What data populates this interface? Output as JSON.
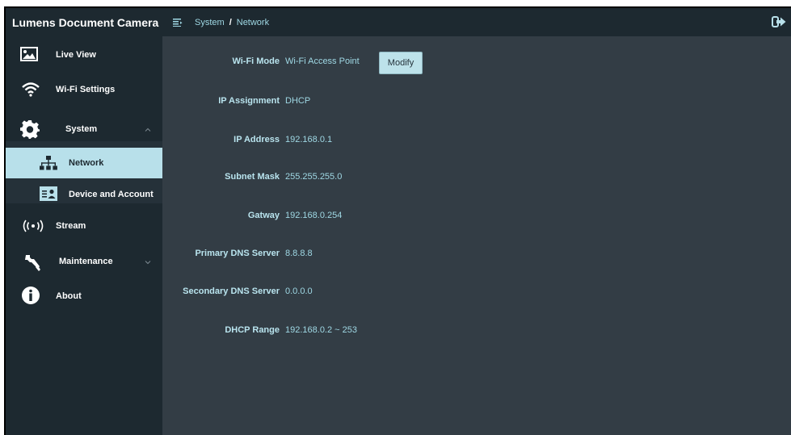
{
  "app": {
    "title": "Lumens Document Camera"
  },
  "breadcrumb": {
    "section": "System",
    "separator": "/",
    "page": "Network"
  },
  "sidebar": {
    "items": [
      {
        "label": "Live View",
        "icon": "image-icon"
      },
      {
        "label": "Wi-Fi Settings",
        "icon": "wifi-icon"
      },
      {
        "label": "System",
        "icon": "gear-icon",
        "expanded": true
      },
      {
        "label": "Network",
        "icon": "network-icon",
        "active": true
      },
      {
        "label": "Device and Account",
        "icon": "id-card-icon"
      },
      {
        "label": "Stream",
        "icon": "broadcast-icon"
      },
      {
        "label": "Maintenance",
        "icon": "wrench-icon",
        "expanded": false
      },
      {
        "label": "About",
        "icon": "info-icon"
      }
    ]
  },
  "network": {
    "wifi_mode": {
      "label": "Wi-Fi Mode",
      "value": "Wi-Fi Access Point",
      "button": "Modify"
    },
    "ip_assignment": {
      "label": "IP Assignment",
      "value": "DHCP"
    },
    "ip_address": {
      "label": "IP Address",
      "value": "192.168.0.1"
    },
    "subnet_mask": {
      "label": "Subnet Mask",
      "value": "255.255.255.0"
    },
    "gateway": {
      "label": "Gatway",
      "value": "192.168.0.254"
    },
    "primary_dns": {
      "label": "Primary DNS Server",
      "value": "8.8.8.8"
    },
    "secondary_dns": {
      "label": "Secondary DNS Server",
      "value": "0.0.0.0"
    },
    "dhcp_range": {
      "label": "DHCP Range",
      "value": "192.168.0.2 ~ 253"
    }
  },
  "colors": {
    "sidebar_bg": "#1d2930",
    "content_bg": "#333d45",
    "accent": "#b8e0ea",
    "value_text": "#9fd8e4"
  }
}
